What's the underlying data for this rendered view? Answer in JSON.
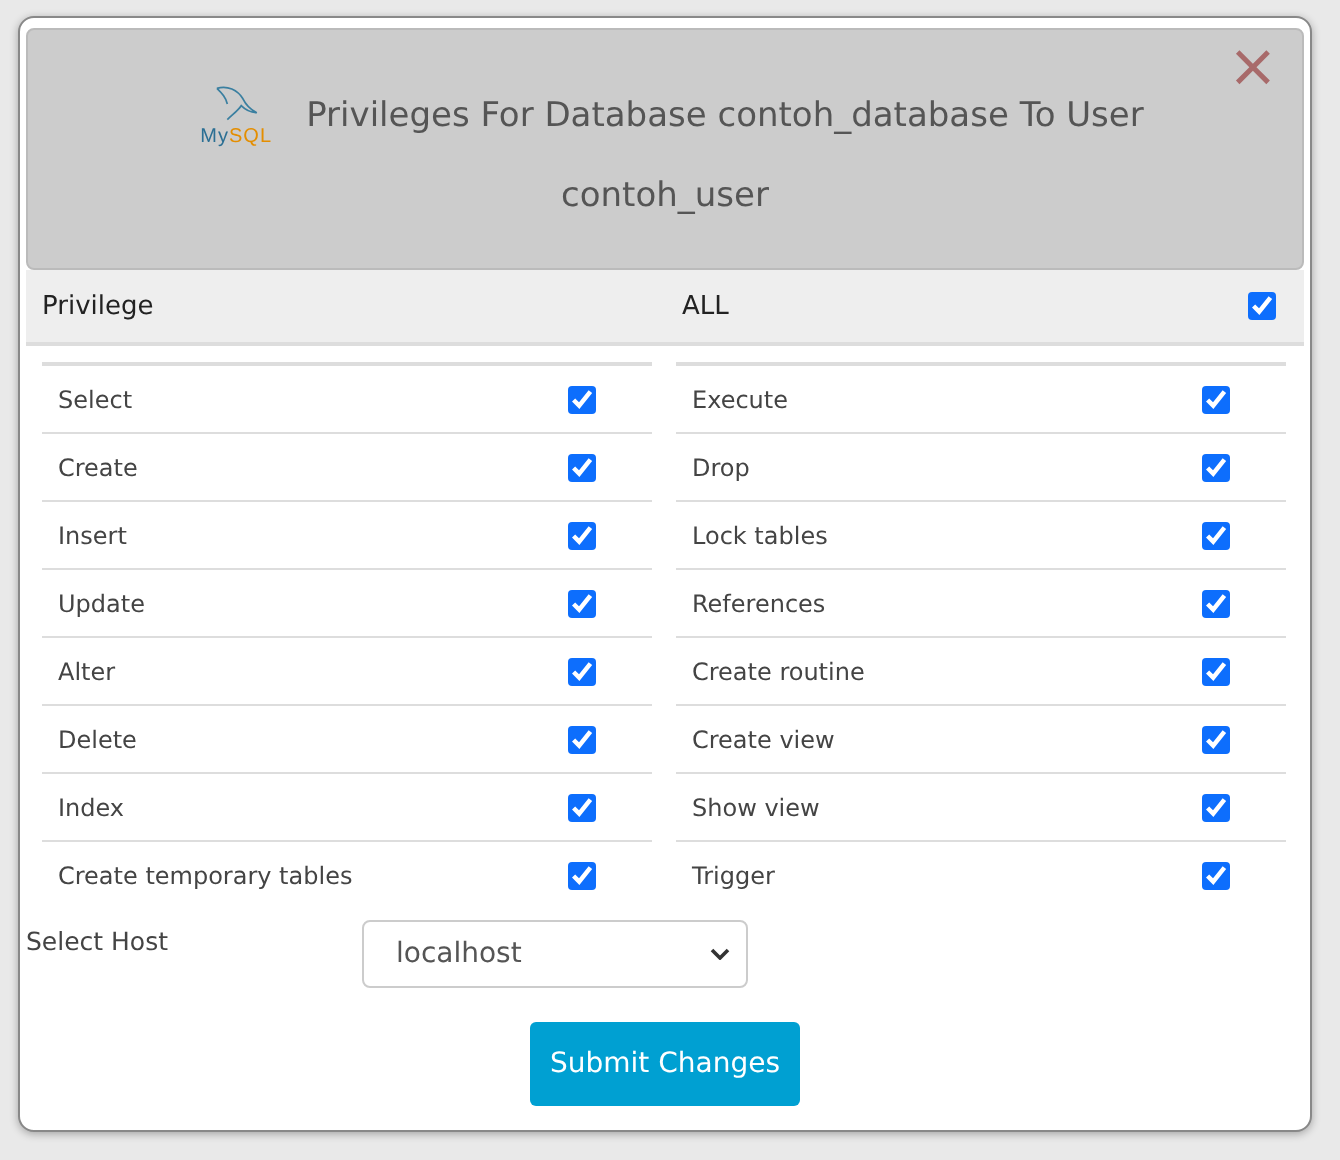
{
  "dialog": {
    "logo_text": [
      "My",
      "SQL"
    ],
    "title": "Privileges For Database contoh_database To User",
    "subtitle": "contoh_user",
    "close": "×"
  },
  "header": {
    "label": "Privilege",
    "all_label": "ALL",
    "all_checked": true
  },
  "columns": [
    [
      {
        "label": "Select",
        "checked": true
      },
      {
        "label": "Create",
        "checked": true
      },
      {
        "label": "Insert",
        "checked": true
      },
      {
        "label": "Update",
        "checked": true
      },
      {
        "label": "Alter",
        "checked": true
      },
      {
        "label": "Delete",
        "checked": true
      },
      {
        "label": "Index",
        "checked": true
      },
      {
        "label": "Create temporary tables",
        "checked": true
      }
    ],
    [
      {
        "label": "Execute",
        "checked": true
      },
      {
        "label": "Drop",
        "checked": true
      },
      {
        "label": "Lock tables",
        "checked": true
      },
      {
        "label": "References",
        "checked": true
      },
      {
        "label": "Create routine",
        "checked": true
      },
      {
        "label": "Create view",
        "checked": true
      },
      {
        "label": "Show view",
        "checked": true
      },
      {
        "label": "Trigger",
        "checked": true
      }
    ]
  ],
  "host": {
    "label": "Select Host",
    "value": "localhost"
  },
  "submit": "Submit Changes"
}
